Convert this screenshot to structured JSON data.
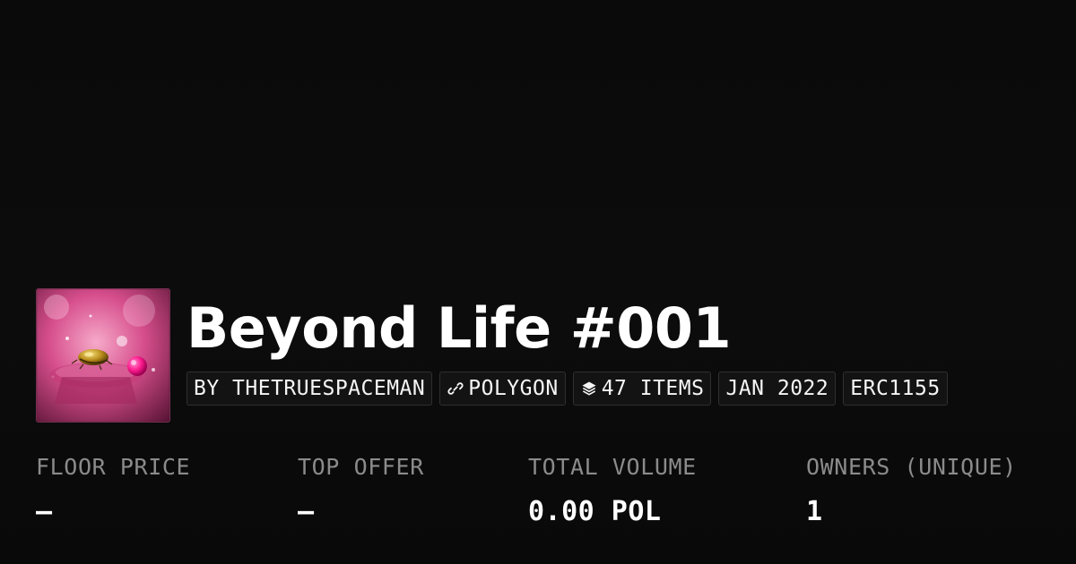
{
  "collection": {
    "title": "Beyond Life #001",
    "thumbnail_icon": "collection-thumbnail-art"
  },
  "meta": {
    "creator": "BY THETRUESPACEMAN",
    "chain_icon": "polygon-link-icon",
    "chain": "POLYGON",
    "items_icon": "layers-icon",
    "items": "47 ITEMS",
    "date": "JAN 2022",
    "standard": "ERC1155"
  },
  "stats": {
    "floor_price": {
      "label": "FLOOR PRICE",
      "value": "–"
    },
    "top_offer": {
      "label": "TOP OFFER",
      "value": "–"
    },
    "total_volume": {
      "label": "TOTAL VOLUME",
      "value": "0.00 POL"
    },
    "owners": {
      "label": "OWNERS (UNIQUE)",
      "value": "1"
    }
  },
  "colors": {
    "background": "#0b0b0b",
    "label_gray": "#8b8b8b",
    "text_white": "#ffffff",
    "chip_border": "#2a2a2a",
    "art_pink": "#e84b9b",
    "art_gold": "#c9a227"
  }
}
